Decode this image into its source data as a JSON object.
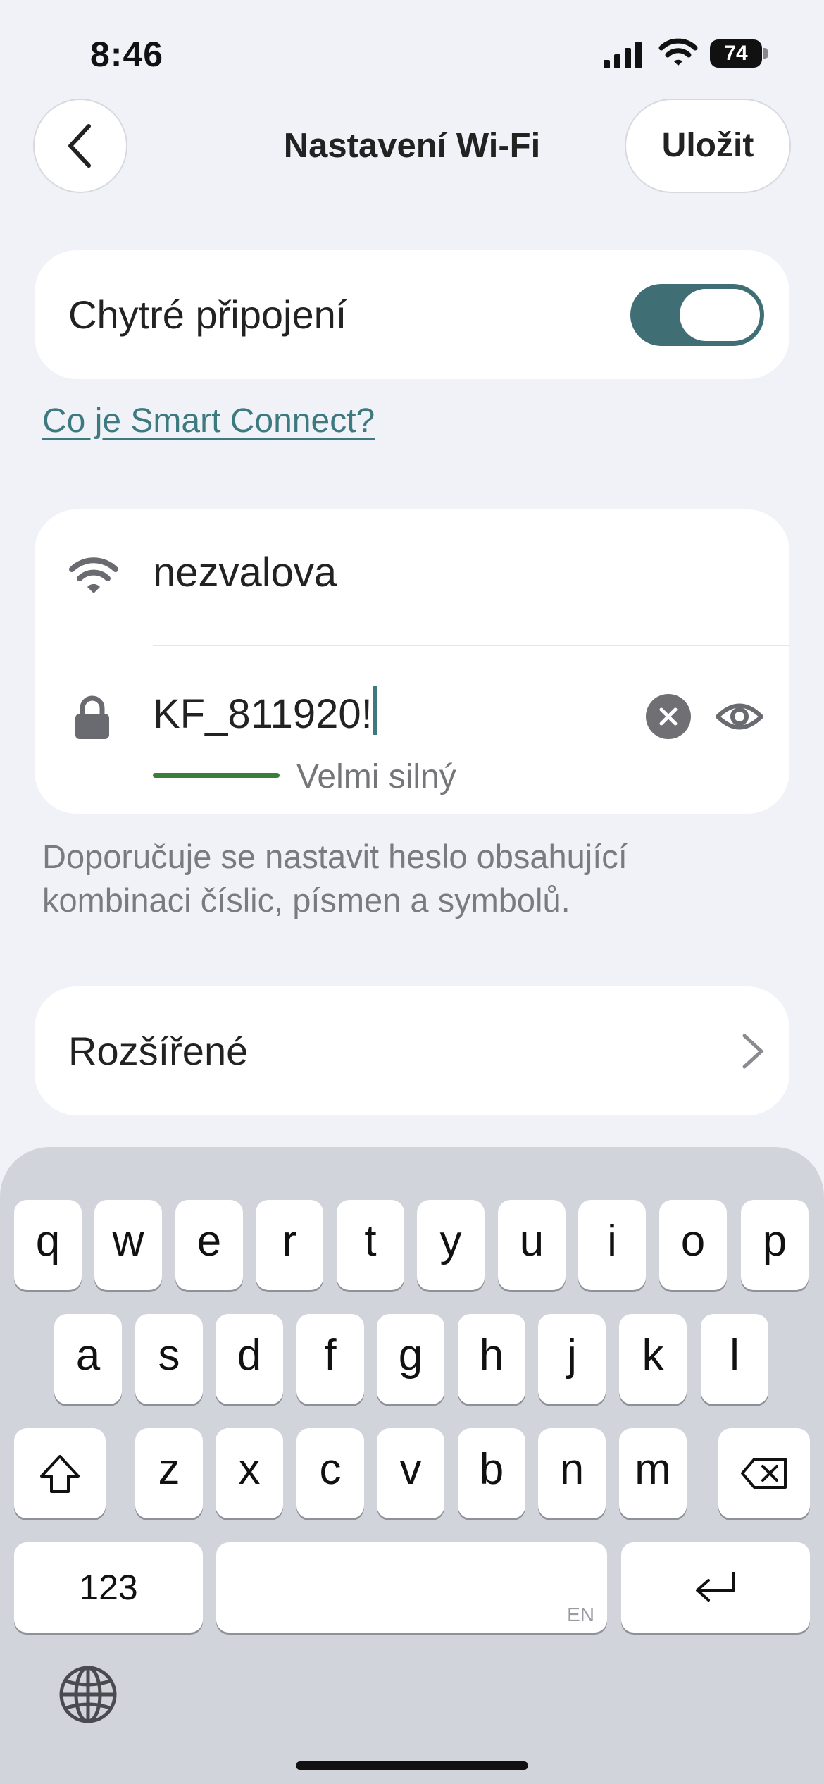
{
  "status_bar": {
    "time": "8:46",
    "battery_level": "74"
  },
  "header": {
    "title": "Nastavení Wi-Fi",
    "save_label": "Uložit",
    "back_icon": "chevron-left-icon"
  },
  "smart_connect": {
    "label": "Chytré připojení",
    "enabled": true,
    "help_link": "Co je Smart Connect?"
  },
  "wifi": {
    "ssid": "nezvalova",
    "password": "KF_811920!",
    "strength_label": "Velmi silný",
    "icons": [
      "wifi-icon",
      "lock-icon",
      "clear-icon",
      "eye-icon"
    ]
  },
  "hint": "Doporučuje se nastavit heslo obsahující kombinaci číslic, písmen a symbolů.",
  "advanced": {
    "label": "Rozšířené"
  },
  "keyboard": {
    "row1": [
      "q",
      "w",
      "e",
      "r",
      "t",
      "y",
      "u",
      "i",
      "o",
      "p"
    ],
    "row2": [
      "a",
      "s",
      "d",
      "f",
      "g",
      "h",
      "j",
      "k",
      "l"
    ],
    "row3": [
      "z",
      "x",
      "c",
      "v",
      "b",
      "n",
      "m"
    ],
    "numbers_key": "123",
    "space_lang": "EN"
  },
  "colors": {
    "accent": "#3f6f75",
    "link": "#3d7a80",
    "strength": "#3d7d3a",
    "background": "#f1f2f7"
  }
}
